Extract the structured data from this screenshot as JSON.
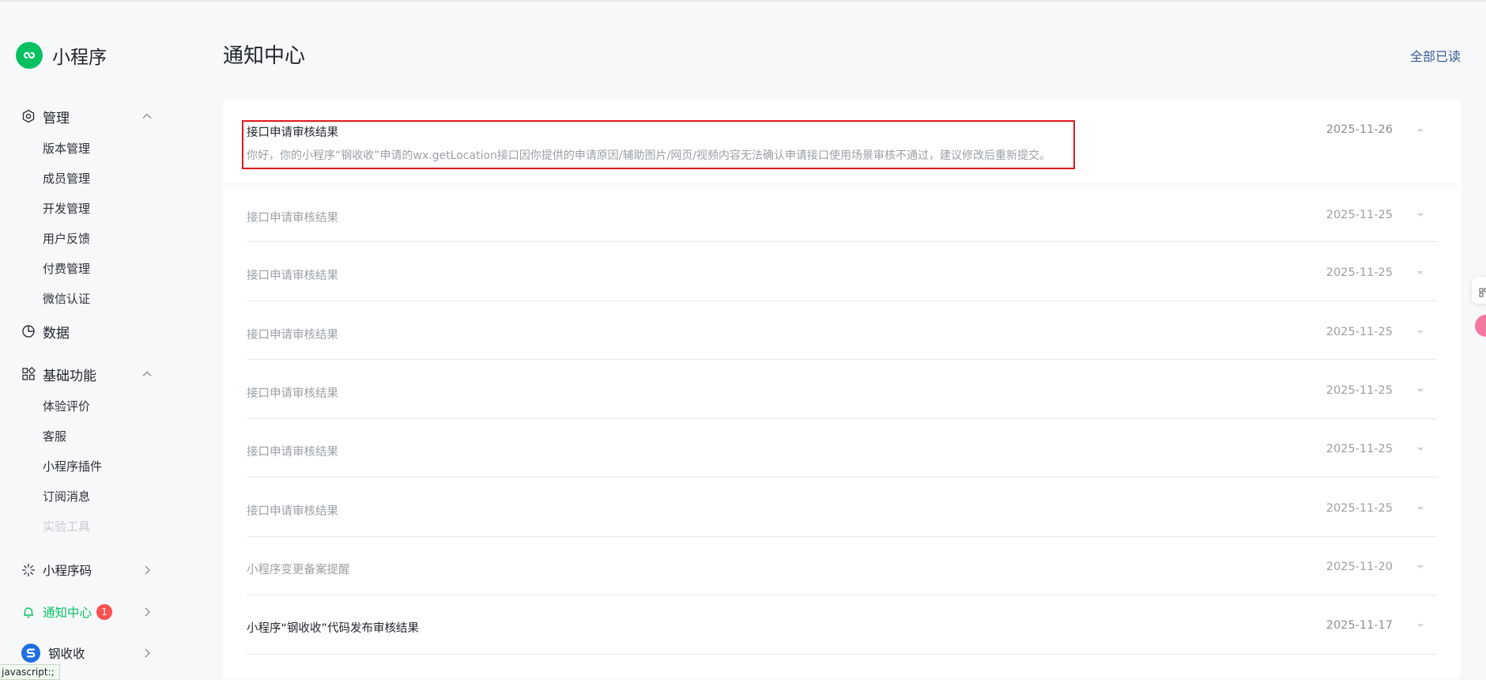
{
  "app": {
    "name": "小程序"
  },
  "sidebar": {
    "groups": [
      {
        "label": "管理",
        "icon": "settings-hex-icon",
        "expanded": true,
        "items": [
          "版本管理",
          "成员管理",
          "开发管理",
          "用户反馈",
          "付费管理",
          "微信认证"
        ]
      },
      {
        "label": "数据",
        "icon": "pie-chart-icon"
      },
      {
        "label": "基础功能",
        "icon": "grid-apps-icon",
        "expanded": true,
        "items": [
          "体验评价",
          "客服",
          "小程序插件",
          "订阅消息",
          "实验工具"
        ]
      },
      {
        "label": "小程序码",
        "icon": "sunburst-icon"
      },
      {
        "label": "通知中心",
        "icon": "bell-icon",
        "badge": "1",
        "active": true
      },
      {
        "label": "钢收收",
        "icon": "account-avatar-icon"
      }
    ]
  },
  "header": {
    "title": "通知中心",
    "mark_all_read": "全部已读"
  },
  "notifications": [
    {
      "title": "接口申请审核结果",
      "date": "2025-11-26",
      "unread": true,
      "expanded": true,
      "body": "你好，你的小程序“钢收收”申请的wx.getLocation接口因你提供的申请原因/辅助图片/网页/视频内容无法确认申请接口使用场景审核不通过，建议修改后重新提交。"
    },
    {
      "title": "接口申请审核结果",
      "date": "2025-11-25"
    },
    {
      "title": "接口申请审核结果",
      "date": "2025-11-25"
    },
    {
      "title": "接口申请审核结果",
      "date": "2025-11-25"
    },
    {
      "title": "接口申请审核结果",
      "date": "2025-11-25"
    },
    {
      "title": "接口申请审核结果",
      "date": "2025-11-25"
    },
    {
      "title": "接口申请审核结果",
      "date": "2025-11-25"
    },
    {
      "title": "小程序变更备案提醒",
      "date": "2025-11-20"
    },
    {
      "title": "小程序“钢收收”代码发布审核结果",
      "date": "2025-11-17",
      "unread": true
    }
  ],
  "status_bar": {
    "text": "javascript:;"
  },
  "colors": {
    "brand": "#07c160",
    "badge": "#fa5151",
    "highlight": "#e0181f",
    "link": "#3a5a94"
  }
}
